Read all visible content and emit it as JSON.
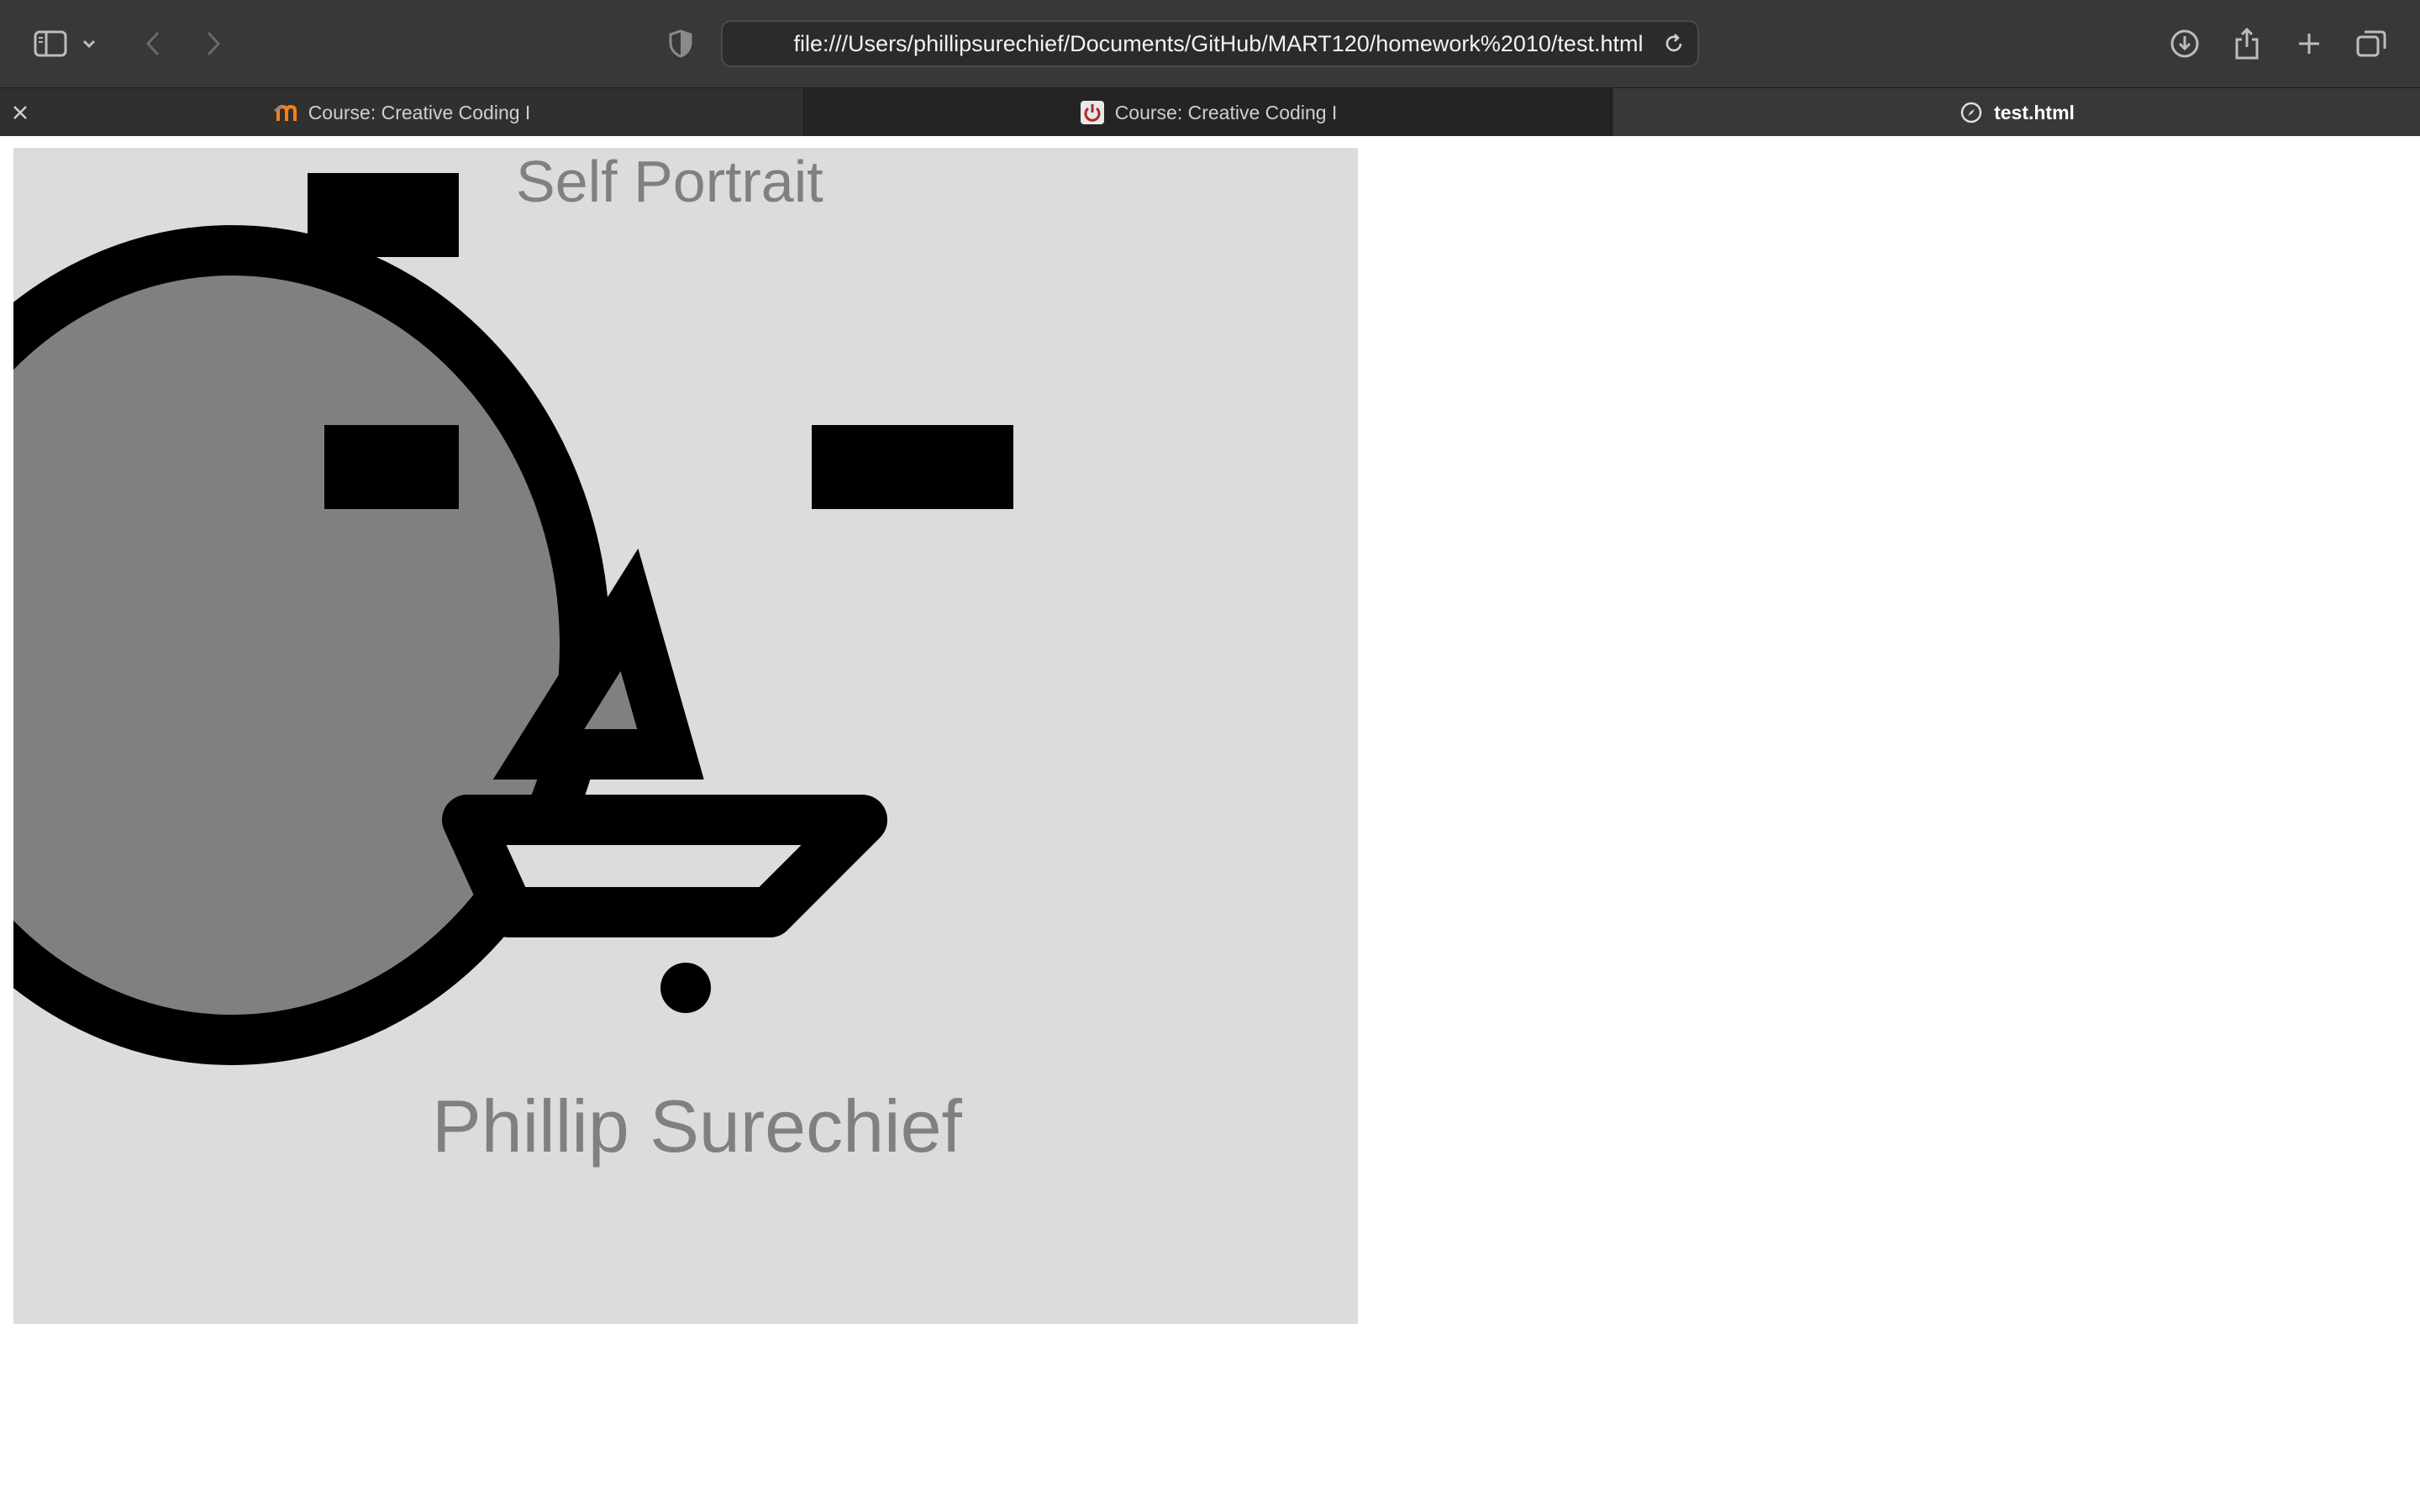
{
  "browser": {
    "url": "file:///Users/phillipsurechief/Documents/GitHub/MART120/homework%2010/test.html",
    "toolbar_icons": [
      "sidebar-icon",
      "chevron-down-icon",
      "back-icon",
      "forward-icon",
      "shield-icon",
      "reload-icon",
      "download-icon",
      "share-icon",
      "new-tab-icon",
      "tab-overview-icon"
    ],
    "tabs": [
      {
        "label": "Course: Creative Coding I",
        "icon": "moodle-icon"
      },
      {
        "label": "Course: Creative Coding I",
        "icon": "power-icon"
      },
      {
        "label": "test.html",
        "icon": "compass-icon"
      }
    ]
  },
  "page": {
    "title": "Self Portrait",
    "author": "Phillip Surechief",
    "canvas_color": "#dcdcdc",
    "text_color": "#808080",
    "shape_fill": "#808080",
    "shape_stroke": "#000000"
  }
}
